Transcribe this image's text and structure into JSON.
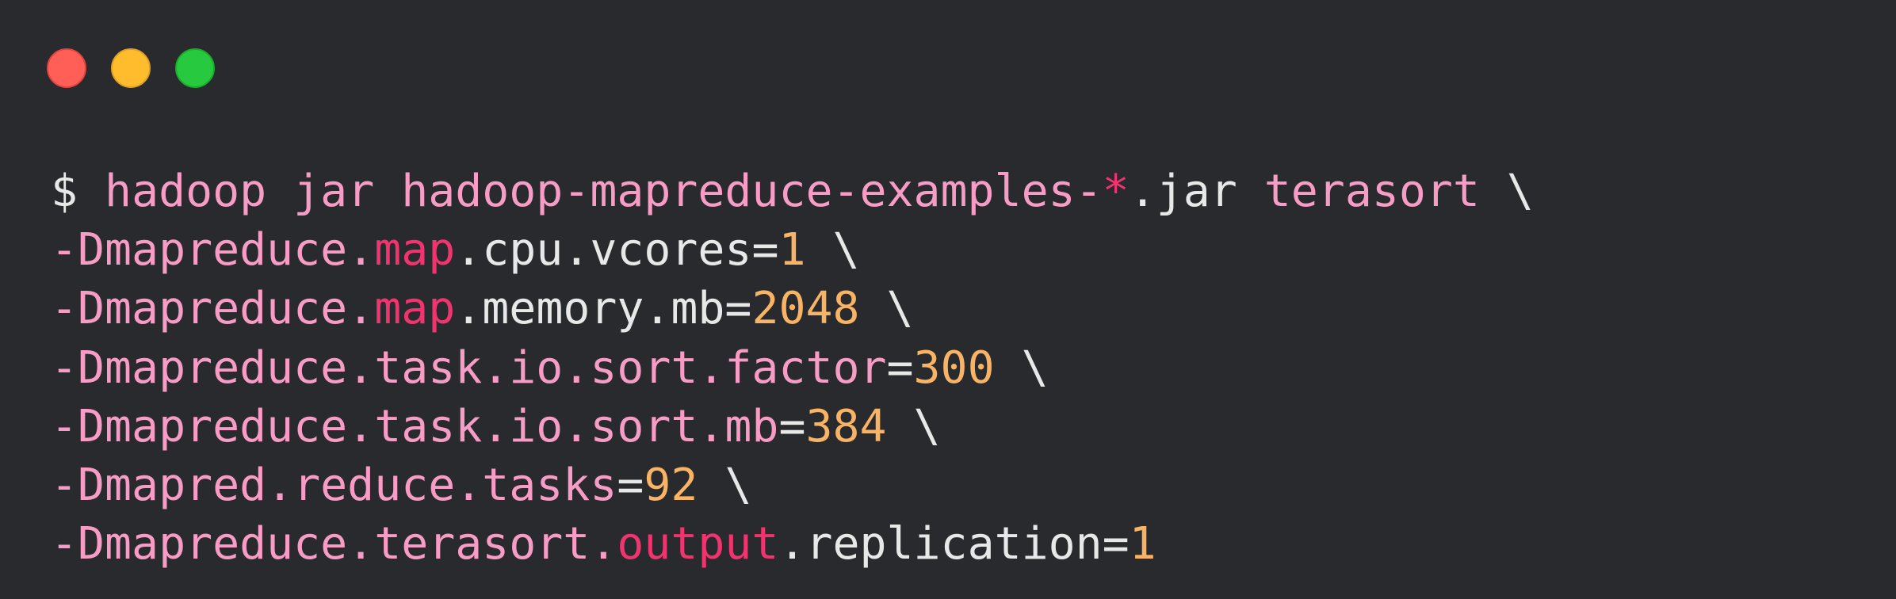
{
  "window": {
    "controls": [
      "close",
      "minimize",
      "zoom"
    ],
    "colors": {
      "background": "#282a2d",
      "close": "#ff5f56",
      "minimize": "#ffbd2e",
      "zoom": "#27c93f"
    }
  },
  "colors": {
    "text": "#e8e8e8",
    "string": "#f79cc4",
    "keyword": "#f0346f",
    "number": "#f9b365"
  },
  "code": {
    "lines": [
      [
        {
          "text": "$ ",
          "kind": "text"
        },
        {
          "text": "hadoop jar hadoop-mapreduce-examples-",
          "kind": "string"
        },
        {
          "text": "*",
          "kind": "keyword"
        },
        {
          "text": ".jar ",
          "kind": "text"
        },
        {
          "text": "terasort",
          "kind": "string"
        },
        {
          "text": " \\",
          "kind": "text"
        }
      ],
      [
        {
          "text": "-Dmapreduce.",
          "kind": "string"
        },
        {
          "text": "map",
          "kind": "keyword"
        },
        {
          "text": ".cpu.vcores=",
          "kind": "text"
        },
        {
          "text": "1",
          "kind": "number"
        },
        {
          "text": " \\",
          "kind": "text"
        }
      ],
      [
        {
          "text": "-Dmapreduce.",
          "kind": "string"
        },
        {
          "text": "map",
          "kind": "keyword"
        },
        {
          "text": ".memory.mb=",
          "kind": "text"
        },
        {
          "text": "2048",
          "kind": "number"
        },
        {
          "text": " \\",
          "kind": "text"
        }
      ],
      [
        {
          "text": "-Dmapreduce.task.io.sort.factor",
          "kind": "string"
        },
        {
          "text": "=",
          "kind": "text"
        },
        {
          "text": "300",
          "kind": "number"
        },
        {
          "text": " \\",
          "kind": "text"
        }
      ],
      [
        {
          "text": "-Dmapreduce.task.io.sort.mb",
          "kind": "string"
        },
        {
          "text": "=",
          "kind": "text"
        },
        {
          "text": "384",
          "kind": "number"
        },
        {
          "text": " \\",
          "kind": "text"
        }
      ],
      [
        {
          "text": "-Dmapred.reduce.tasks",
          "kind": "string"
        },
        {
          "text": "=",
          "kind": "text"
        },
        {
          "text": "92",
          "kind": "number"
        },
        {
          "text": " \\",
          "kind": "text"
        }
      ],
      [
        {
          "text": "-Dmapreduce.terasort.",
          "kind": "string"
        },
        {
          "text": "output",
          "kind": "keyword"
        },
        {
          "text": ".replication=",
          "kind": "text"
        },
        {
          "text": "1",
          "kind": "number"
        }
      ]
    ]
  }
}
